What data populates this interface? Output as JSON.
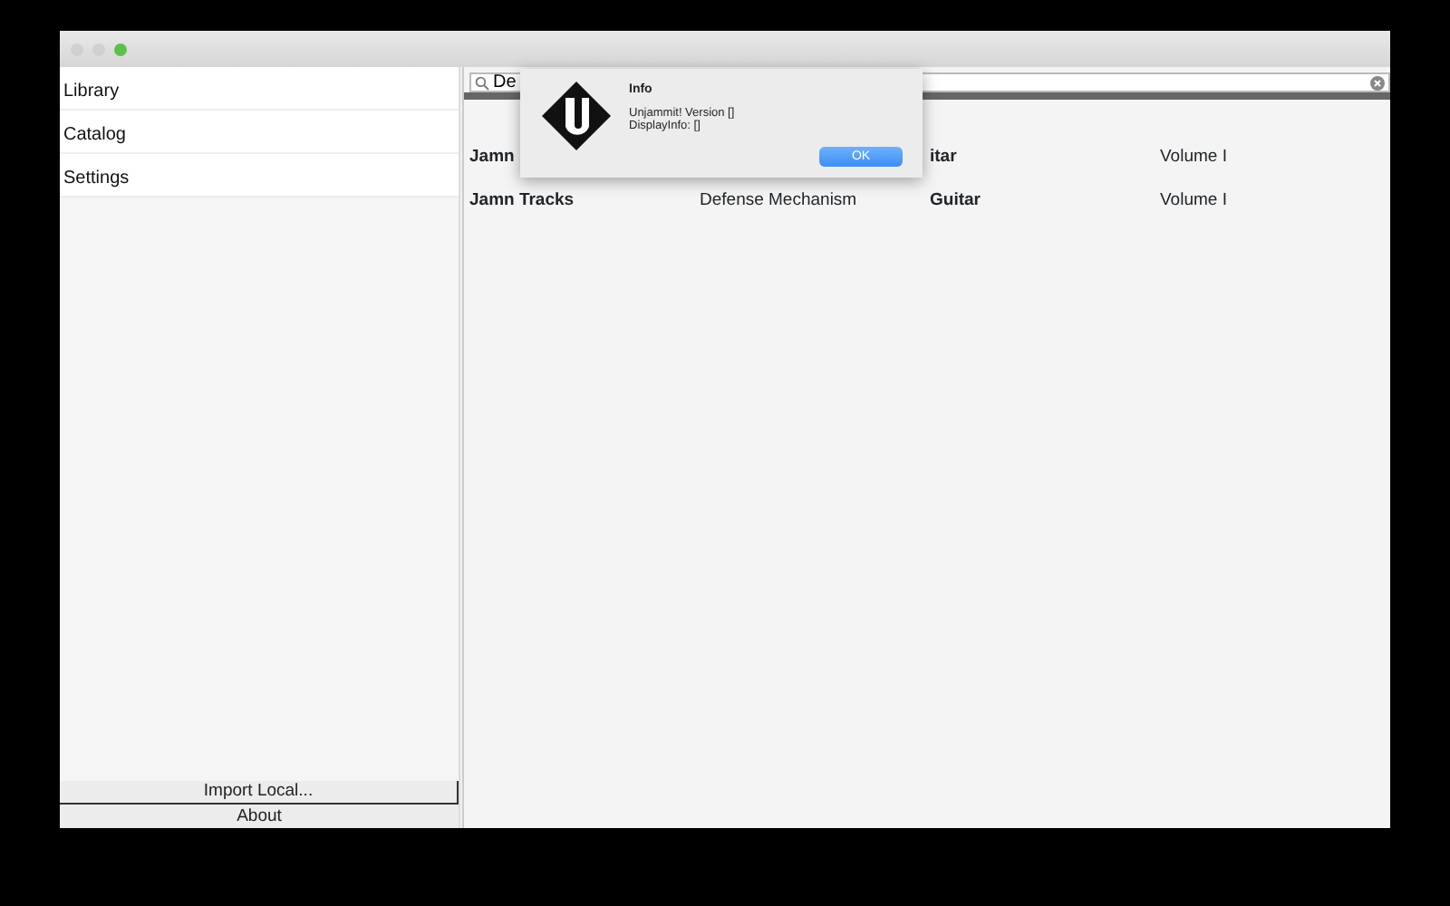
{
  "sidebar": {
    "items": [
      {
        "label": "Library"
      },
      {
        "label": "Catalog"
      },
      {
        "label": "Settings"
      }
    ],
    "buttons": [
      "Import Local...",
      "About"
    ]
  },
  "search": {
    "value": "De"
  },
  "table": {
    "rows": [
      {
        "cells": [
          "Jamn",
          "",
          "itar",
          "Volume I"
        ]
      },
      {
        "cells": [
          "Jamn Tracks",
          "Defense Mechanism",
          "Guitar",
          "Volume I"
        ]
      }
    ]
  },
  "dialog": {
    "title": "Info",
    "lines": [
      "Unjammit! Version []",
      "DisplayInfo: []"
    ],
    "button": "OK"
  }
}
